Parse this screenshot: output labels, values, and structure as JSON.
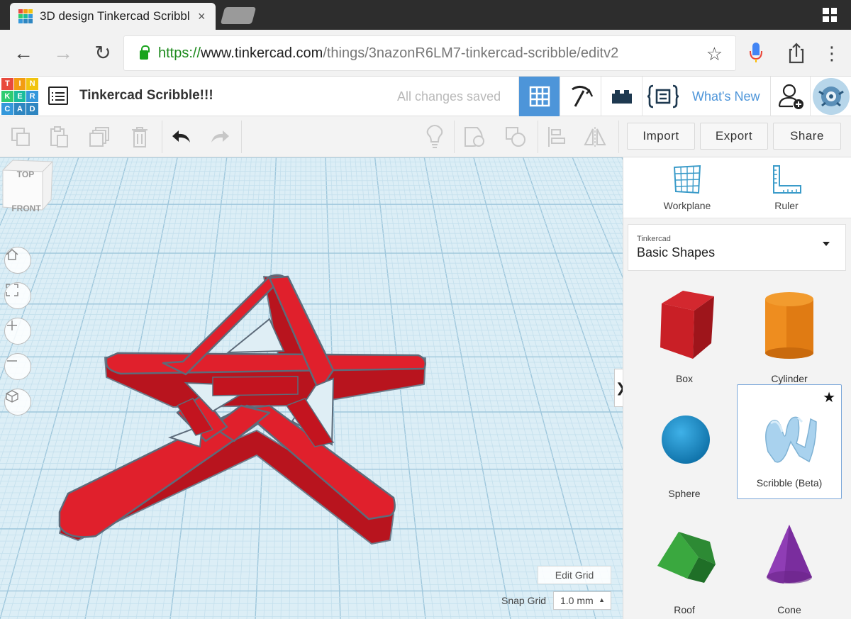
{
  "browser": {
    "tab_title": "3D design Tinkercad Scribbl",
    "tab_close": "×",
    "url_scheme": "https://",
    "url_host": "www.tinkercad.com",
    "url_path": "/things/3nazonR6LM7-tinkercad-scribble/editv2",
    "back": "←",
    "forward": "→",
    "reload": "↻",
    "bookmark_star": "☆",
    "menu": "⋮"
  },
  "app": {
    "logo_letters": [
      "T",
      "I",
      "N",
      "K",
      "E",
      "R",
      "C",
      "A",
      "D"
    ],
    "logo_colors": [
      "#e84a3d",
      "#f39c12",
      "#f1c40f",
      "#2ecc71",
      "#1abc9c",
      "#3498db",
      "#3498db",
      "#2e86c1",
      "#2e86c1"
    ],
    "design_title": "Tinkercad Scribble!!!",
    "save_status": "All changes saved",
    "whats_new": "What's New",
    "accent": "#4d95d9"
  },
  "toolbar": {
    "import_label": "Import",
    "export_label": "Export",
    "share_label": "Share"
  },
  "viewcube": {
    "top": "TOP",
    "front": "FRONT"
  },
  "workplane": {
    "edit_grid": "Edit Grid",
    "snap_grid_label": "Snap Grid",
    "snap_grid_value": "1.0 mm",
    "collapse_glyph": "❯"
  },
  "panel": {
    "workplane_label": "Workplane",
    "ruler_label": "Ruler",
    "library_provider": "Tinkercad",
    "library_name": "Basic Shapes",
    "shapes": [
      {
        "label": "Box"
      },
      {
        "label": "Cylinder"
      },
      {
        "label": "Sphere"
      },
      {
        "label": "Scribble (Beta)"
      },
      {
        "label": "Roof"
      },
      {
        "label": "Cone"
      }
    ]
  }
}
